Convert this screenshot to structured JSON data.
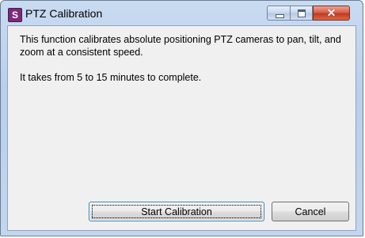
{
  "window": {
    "title": "PTZ Calibration",
    "app_icon_letter": "S",
    "app_icon_color": "#7a2b7a",
    "controls": {
      "minimize_icon": "minimize-icon",
      "maximize_icon": "maximize-icon",
      "close_icon": "close-icon",
      "close_glyph": "✕"
    }
  },
  "content": {
    "description": "This function calibrates absolute positioning PTZ cameras to pan, tilt, and zoom at a consistent speed.",
    "duration": "It takes from 5 to 15 minutes to complete."
  },
  "buttons": {
    "start_label": "Start Calibration",
    "cancel_label": "Cancel"
  }
}
